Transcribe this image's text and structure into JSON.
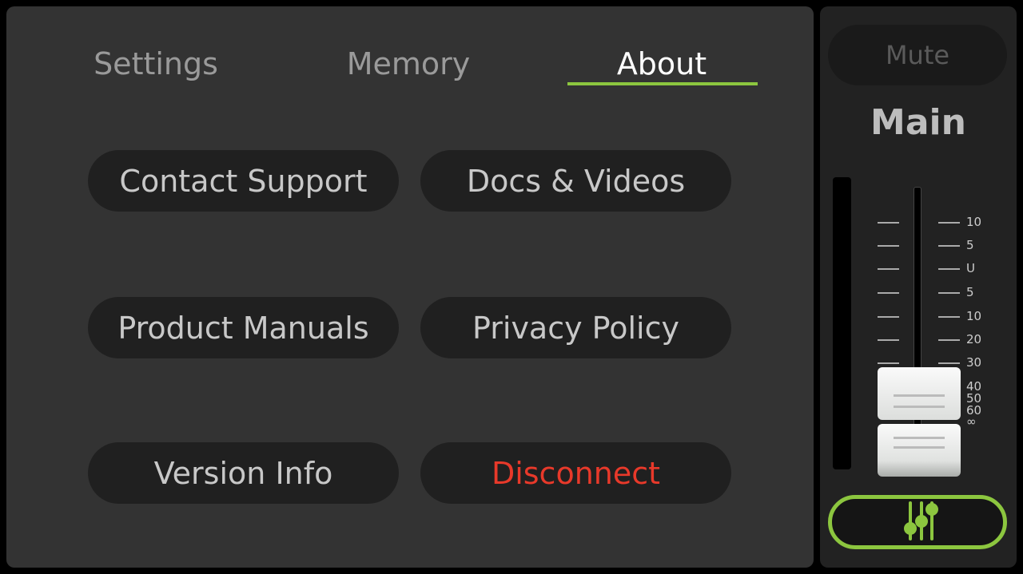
{
  "tabs": [
    {
      "label": "Settings",
      "active": false
    },
    {
      "label": "Memory",
      "active": false
    },
    {
      "label": "About",
      "active": true
    }
  ],
  "buttons": {
    "contact_support": "Contact Support",
    "docs_videos": "Docs & Videos",
    "product_manuals": "Product Manuals",
    "privacy_policy": "Privacy Policy",
    "version_info": "Version Info",
    "disconnect": "Disconnect"
  },
  "channel": {
    "mute_label": "Mute",
    "name": "Main",
    "fader_value": "∞",
    "scale": [
      "10",
      "5",
      "U",
      "5",
      "10",
      "20",
      "30",
      "40",
      "50",
      "60",
      "∞"
    ]
  },
  "colors": {
    "accent": "#8cc63f",
    "disconnect": "#e8392a"
  },
  "icons": {
    "mixer": "mixer-sliders-icon"
  }
}
